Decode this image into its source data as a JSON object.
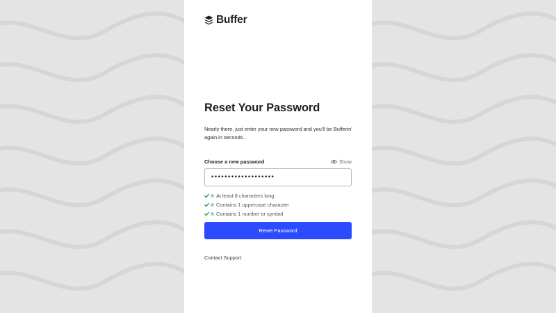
{
  "brand": {
    "name": "Buffer",
    "logo_icon": "buffer-stack-icon"
  },
  "heading": "Reset Your Password",
  "subtitle": "Nearly there, just enter your new password and you'll be Bufferin' again in seconds..",
  "password_field": {
    "label": "Choose a new password",
    "show_label": "Show",
    "show_icon": "eye-icon",
    "value": "•••••••••••••••••••"
  },
  "requirements": [
    {
      "text": "At least 8 characters long",
      "met": true
    },
    {
      "text": "Contains 1 uppercase character",
      "met": true
    },
    {
      "text": "Contains 1 number or symbol",
      "met": true
    }
  ],
  "reset_button_label": "Reset Password",
  "contact_support_label": "Contact Support",
  "colors": {
    "primary": "#2c4bff",
    "check": "#2a8f5c",
    "requirement_dot": "#9ed1c2",
    "background": "#e4e4e4",
    "panel": "#ffffff"
  }
}
